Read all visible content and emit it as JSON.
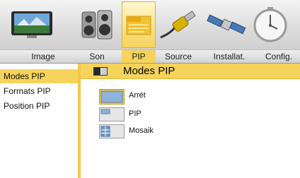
{
  "menu": {
    "tabs": [
      {
        "label": "Image",
        "icon": "tv-landscape-icon",
        "active": false
      },
      {
        "label": "Son",
        "icon": "speaker-icon",
        "active": false
      },
      {
        "label": "PIP",
        "icon": "pip-icon",
        "active": true
      },
      {
        "label": "Source",
        "icon": "plug-icon",
        "active": false
      },
      {
        "label": "Installat.",
        "icon": "satellite-icon",
        "active": false
      },
      {
        "label": "Config.",
        "icon": "clock-icon",
        "active": false
      }
    ]
  },
  "left_panel": {
    "items": [
      {
        "label": "Modes PIP",
        "selected": true
      },
      {
        "label": "Formats PIP",
        "selected": false
      },
      {
        "label": "Position PIP",
        "selected": false
      }
    ]
  },
  "main": {
    "title": "Modes PIP",
    "options": [
      {
        "label": "Arrét",
        "icon": "pip-off-icon",
        "selected": true
      },
      {
        "label": "PIP",
        "icon": "pip-window-icon",
        "selected": false
      },
      {
        "label": "Mosaik",
        "icon": "mosaic-icon",
        "selected": false
      }
    ]
  },
  "colors": {
    "accent": "#f6d35a",
    "accent_border": "#f2c84b",
    "bar_gray": "#d2d2d2"
  }
}
